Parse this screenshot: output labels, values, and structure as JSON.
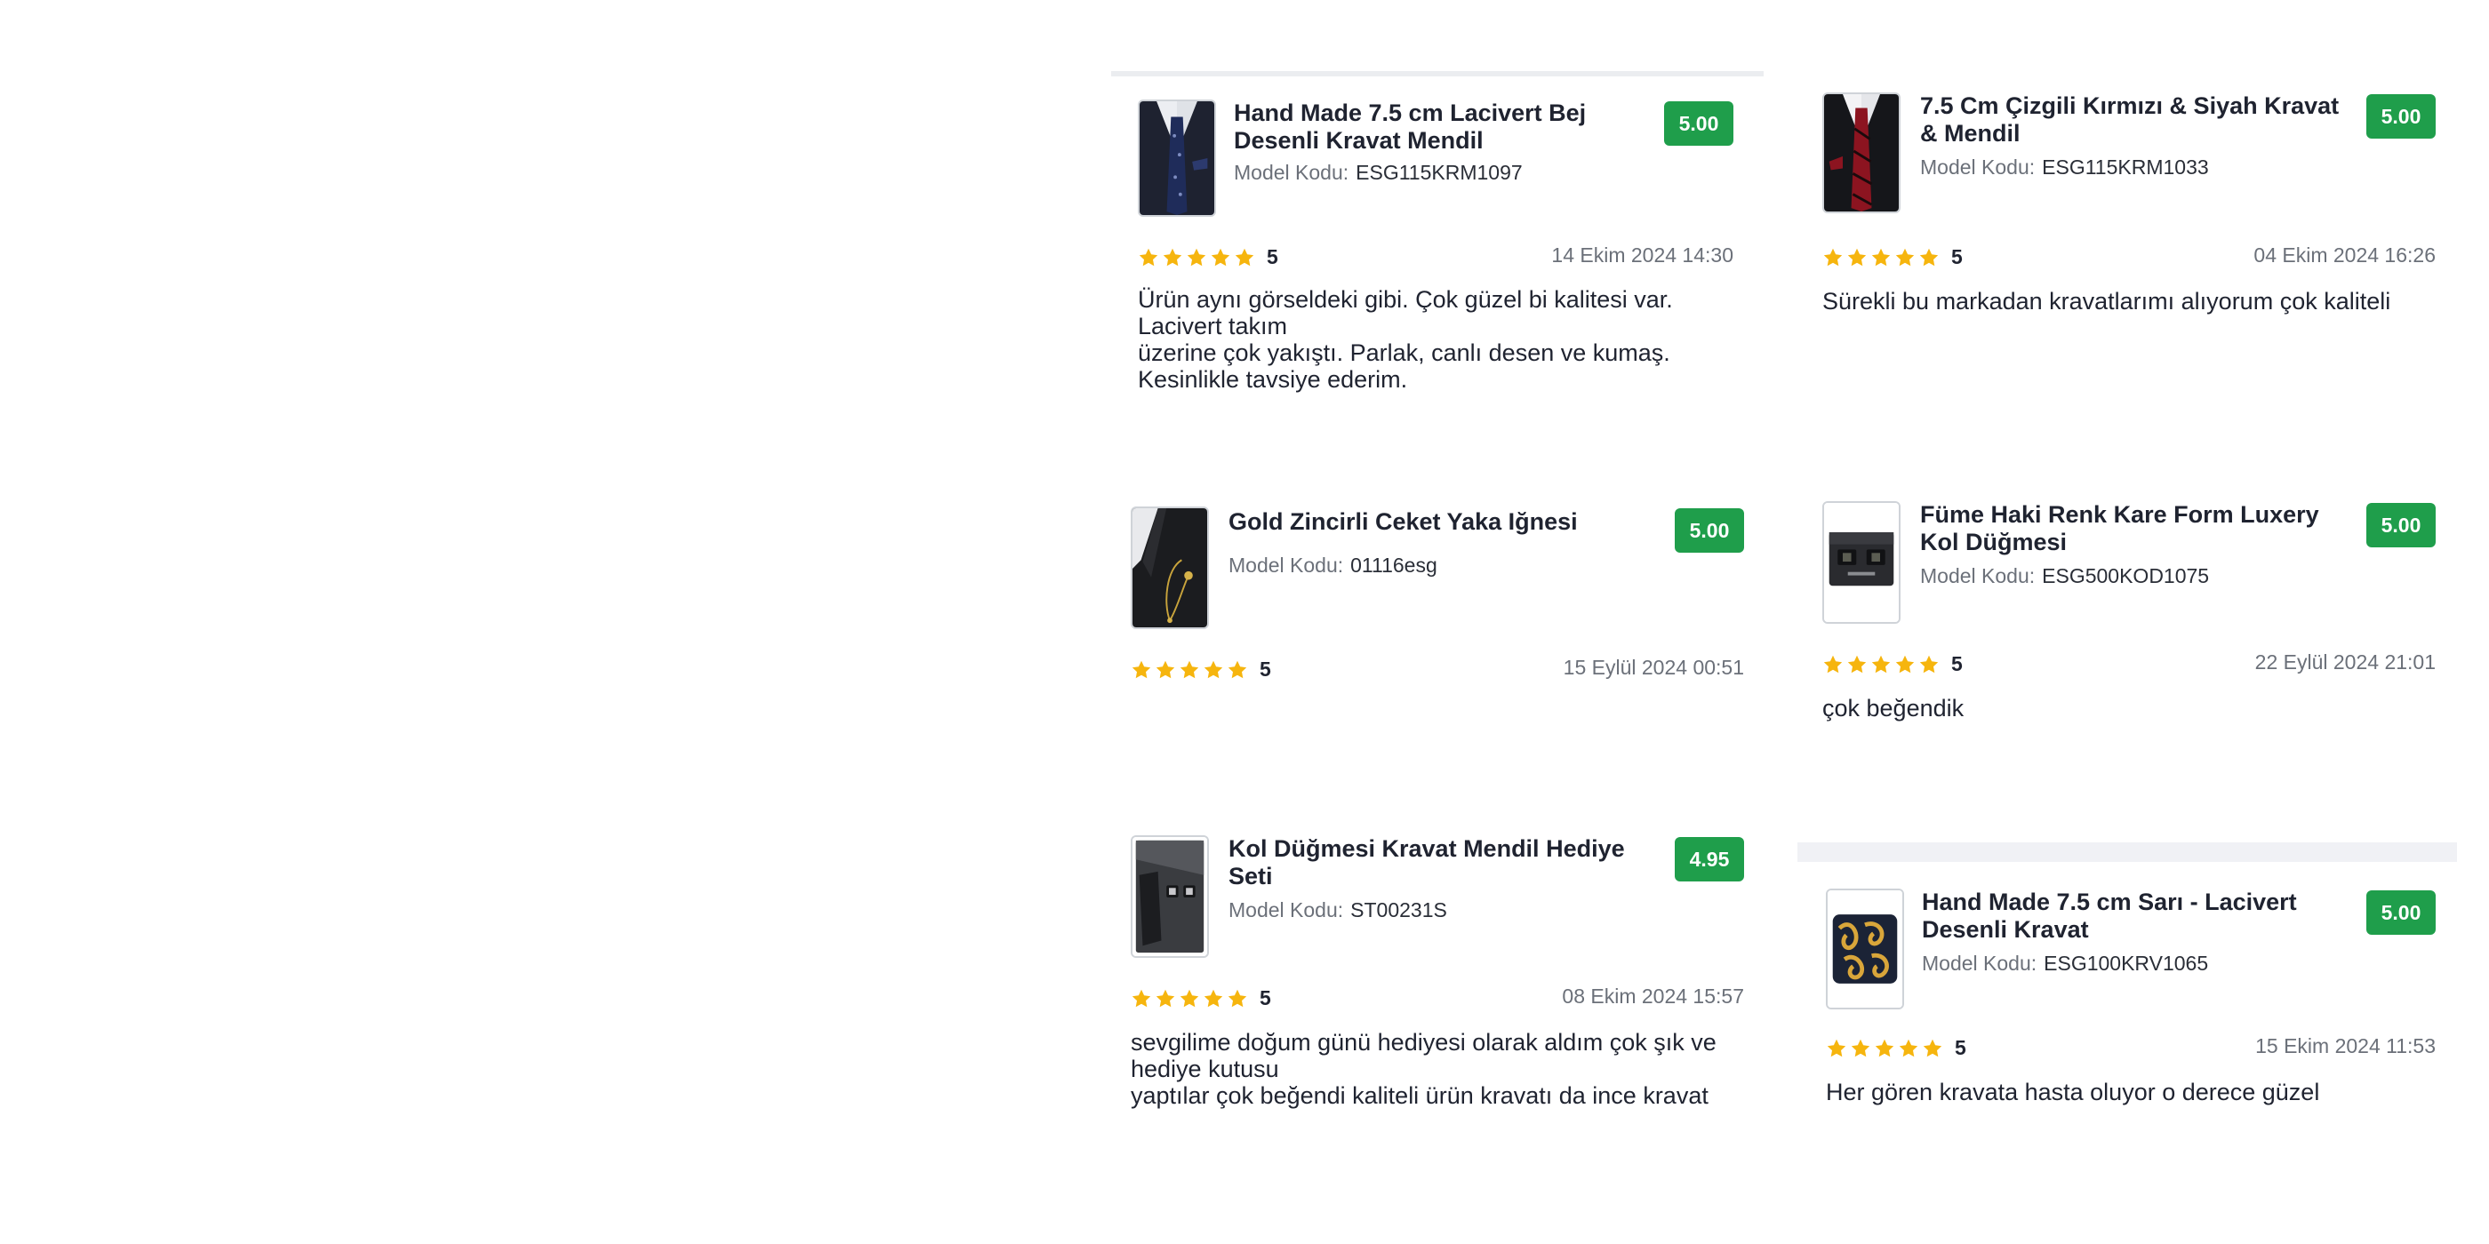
{
  "colors": {
    "score_badge": "#1f9e4b",
    "star": "#f6b50e",
    "divider": "#ebedf0",
    "banner": "#f0f1f5"
  },
  "labels": {
    "model_code": "Model Kodu:"
  },
  "reviews": [
    {
      "title": "Hand Made 7.5 cm Lacivert Bej Desenli Kravat Mendil",
      "model_code": "ESG115KRM1097",
      "score": "5.00",
      "stars": 5,
      "rating": "5",
      "date": "14 Ekim 2024 14:30",
      "comment": "Ürün aynı görseldeki gibi. Çok güzel bi kalitesi var. Lacivert takım\nüzerine çok yakıştı. Parlak, canlı desen ve kumaş. Kesinlikle tavsiye ederim.",
      "image": "navy-tie-photo"
    },
    {
      "title": "7.5 Cm Çizgili Kırmızı & Siyah Kravat & Mendil",
      "model_code": "ESG115KRM1033",
      "score": "5.00",
      "stars": 5,
      "rating": "5",
      "date": "04 Ekim 2024 16:26",
      "comment": "Sürekli bu markadan kravatlarımı alıyorum çok kaliteli",
      "image": "red-black-tie-photo"
    },
    {
      "title": "Gold Zincirli Ceket Yaka Iğnesi",
      "model_code": "01116esg",
      "score": "5.00",
      "stars": 5,
      "rating": "5",
      "date": "15 Eylül 2024 00:51",
      "comment": "",
      "image": "lapel-pin-photo"
    },
    {
      "title": "Füme Haki Renk Kare Form Luxery Kol Düğmesi",
      "model_code": "ESG500KOD1075",
      "score": "5.00",
      "stars": 5,
      "rating": "5",
      "date": "22 Eylül 2024 21:01",
      "comment": "çok beğendik",
      "image": "cufflinks-box-photo"
    },
    {
      "title": "Kol Düğmesi  Kravat Mendil Hediye Seti",
      "model_code": "ST00231S",
      "score": "4.95",
      "stars": 5,
      "rating": "5",
      "date": "08 Ekim 2024 15:57",
      "comment": "sevgilime doğum günü hediyesi olarak aldım çok şık ve hediye kutusu\nyaptılar çok beğendi kaliteli ürün kravatı da ince kravat",
      "image": "gift-set-photo"
    },
    {
      "title": "Hand Made 7.5 cm Sarı - Lacivert Desenli Kravat",
      "model_code": "ESG100KRV1065",
      "score": "5.00",
      "stars": 5,
      "rating": "5",
      "date": "15 Ekim 2024 11:53",
      "comment": "Her gören kravata hasta oluyor o derece güzel",
      "image": "paisley-tie-photo"
    }
  ]
}
